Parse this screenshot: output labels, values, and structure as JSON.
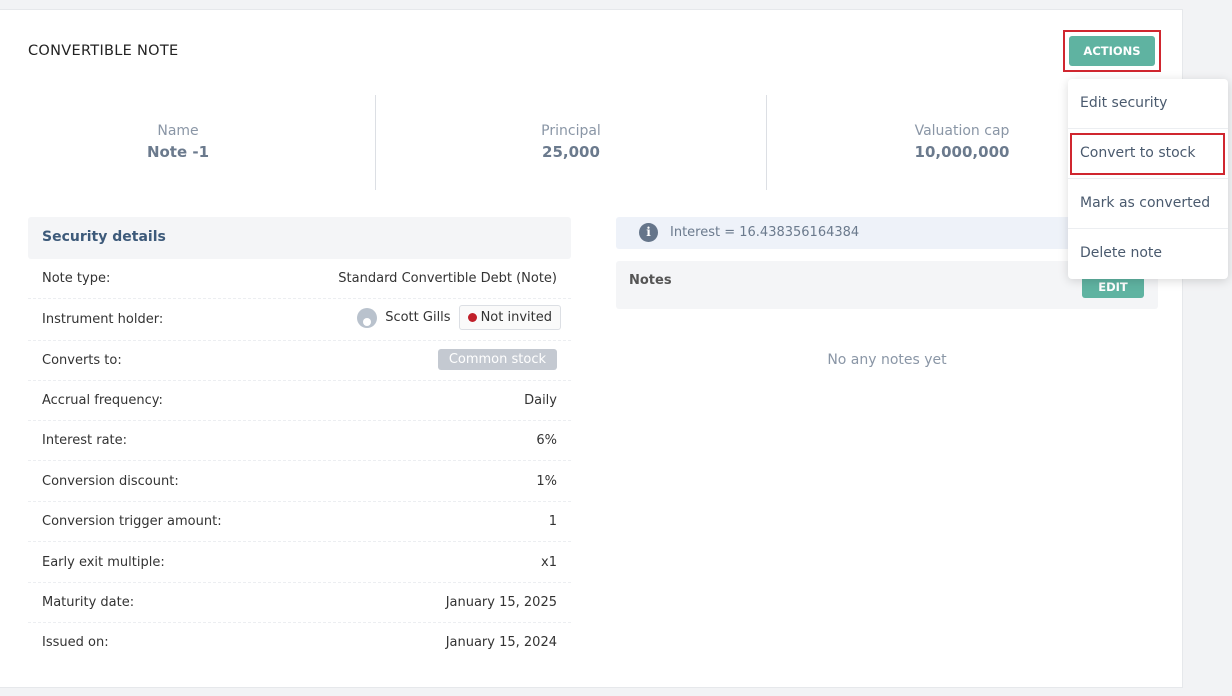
{
  "header": {
    "title": "CONVERTIBLE NOTE",
    "actions_label": "ACTIONS"
  },
  "summary": [
    {
      "label": "Name",
      "value": "Note -1"
    },
    {
      "label": "Principal",
      "value": "25,000"
    },
    {
      "label": "Valuation cap",
      "value": "10,000,000"
    }
  ],
  "security": {
    "title": "Security details",
    "rows": {
      "note_type": {
        "label": "Note type:",
        "value": "Standard Convertible Debt (Note)"
      },
      "holder": {
        "label": "Instrument holder:",
        "name": "Scott Gills",
        "status": "Not invited"
      },
      "converts_to": {
        "label": "Converts to:",
        "value": "Common stock"
      },
      "accrual": {
        "label": "Accrual frequency:",
        "value": "Daily"
      },
      "interest_rate": {
        "label": "Interest rate:",
        "value": "6%"
      },
      "discount": {
        "label": "Conversion discount:",
        "value": "1%"
      },
      "trigger": {
        "label": "Conversion trigger amount:",
        "value": "1"
      },
      "exit": {
        "label": "Early exit multiple:",
        "value": "x1"
      },
      "maturity": {
        "label": "Maturity date:",
        "value": "January 15, 2025"
      },
      "issued": {
        "label": "Issued on:",
        "value": "January 15, 2024"
      }
    }
  },
  "interest": {
    "text": "Interest = 16.438356164384",
    "icon": "info-icon"
  },
  "notes": {
    "title": "Notes",
    "edit_label": "EDIT",
    "empty_text": "No any notes yet"
  },
  "menu": {
    "items": [
      "Edit security",
      "Convert to stock",
      "Mark as converted",
      "Delete note"
    ]
  },
  "colors": {
    "accent": "#5fb3a1",
    "highlight": "#d0262f",
    "status_dot": "#c01f2a"
  }
}
